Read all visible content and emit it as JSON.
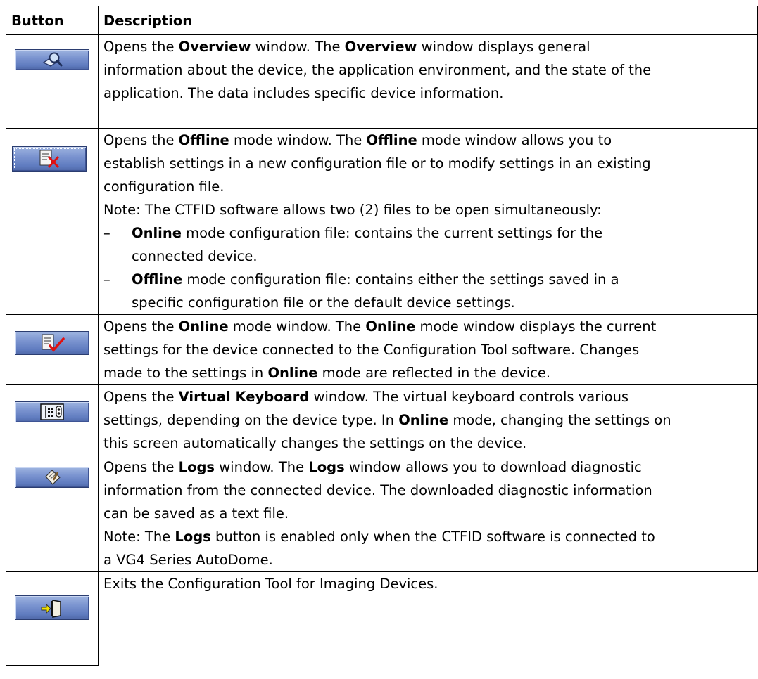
{
  "header": {
    "col1": "Button",
    "col2": "Description"
  },
  "rows": [
    {
      "icon": "overview-magnifier-icon",
      "lines": [
        [
          "Opens the ",
          {
            "b": "Overview"
          },
          " window. The ",
          {
            "b": "Overview"
          },
          " window displays general"
        ],
        [
          "information about the device, the application environment, and the state of the"
        ],
        [
          "application. The data includes specific device information."
        ]
      ]
    },
    {
      "icon": "offline-document-x-icon",
      "lines": [
        [
          "Opens the ",
          {
            "b": "Offline"
          },
          " mode window. The ",
          {
            "b": "Offline"
          },
          " mode window allows you to"
        ],
        [
          "establish settings in a new configuration file or to modify settings in an existing"
        ],
        [
          "configuration file."
        ],
        [
          "Note: The CTFID software allows two (2) files to be open simultaneously:"
        ]
      ],
      "bullets": [
        {
          "dash": "–",
          "lines": [
            [
              {
                "b": "Online"
              },
              " mode configuration file: contains the current settings for the"
            ],
            [
              "connected device."
            ]
          ]
        },
        {
          "dash": "–",
          "lines": [
            [
              {
                "b": "Offline"
              },
              " mode configuration file: contains either the settings saved in a"
            ],
            [
              "specific configuration file or the default device settings."
            ]
          ]
        }
      ]
    },
    {
      "icon": "online-document-check-icon",
      "lines": [
        [
          "Opens the ",
          {
            "b": "Online"
          },
          " mode window. The ",
          {
            "b": "Online"
          },
          " mode window displays the current"
        ],
        [
          "settings for the device connected to the Configuration Tool software. Changes"
        ],
        [
          "made to the settings in ",
          {
            "b": "Online"
          },
          " mode are reflected in the device."
        ]
      ]
    },
    {
      "icon": "virtual-keyboard-icon",
      "lines": [
        [
          "Opens the ",
          {
            "b": "Virtual Keyboard"
          },
          " window. The virtual keyboard controls various"
        ],
        [
          "settings, depending on the device type. In ",
          {
            "b": "Online"
          },
          " mode, changing the settings on"
        ],
        [
          "this screen automatically changes the settings on the device."
        ]
      ]
    },
    {
      "icon": "logs-clipboard-icon",
      "lines": [
        [
          "Opens the ",
          {
            "b": "Logs"
          },
          " window. The ",
          {
            "b": "Logs"
          },
          " window allows you to download diagnostic"
        ],
        [
          "information from the connected device. The downloaded diagnostic information"
        ],
        [
          "can be saved as a text file."
        ],
        [
          "Note: The ",
          {
            "b": "Logs"
          },
          " button is enabled only when the CTFID software is connected to"
        ],
        [
          "a VG4 Series AutoDome."
        ]
      ]
    },
    {
      "icon": "exit-door-arrow-icon",
      "lines": [
        [
          "Exits the Configuration Tool for Imaging Devices."
        ]
      ]
    }
  ]
}
